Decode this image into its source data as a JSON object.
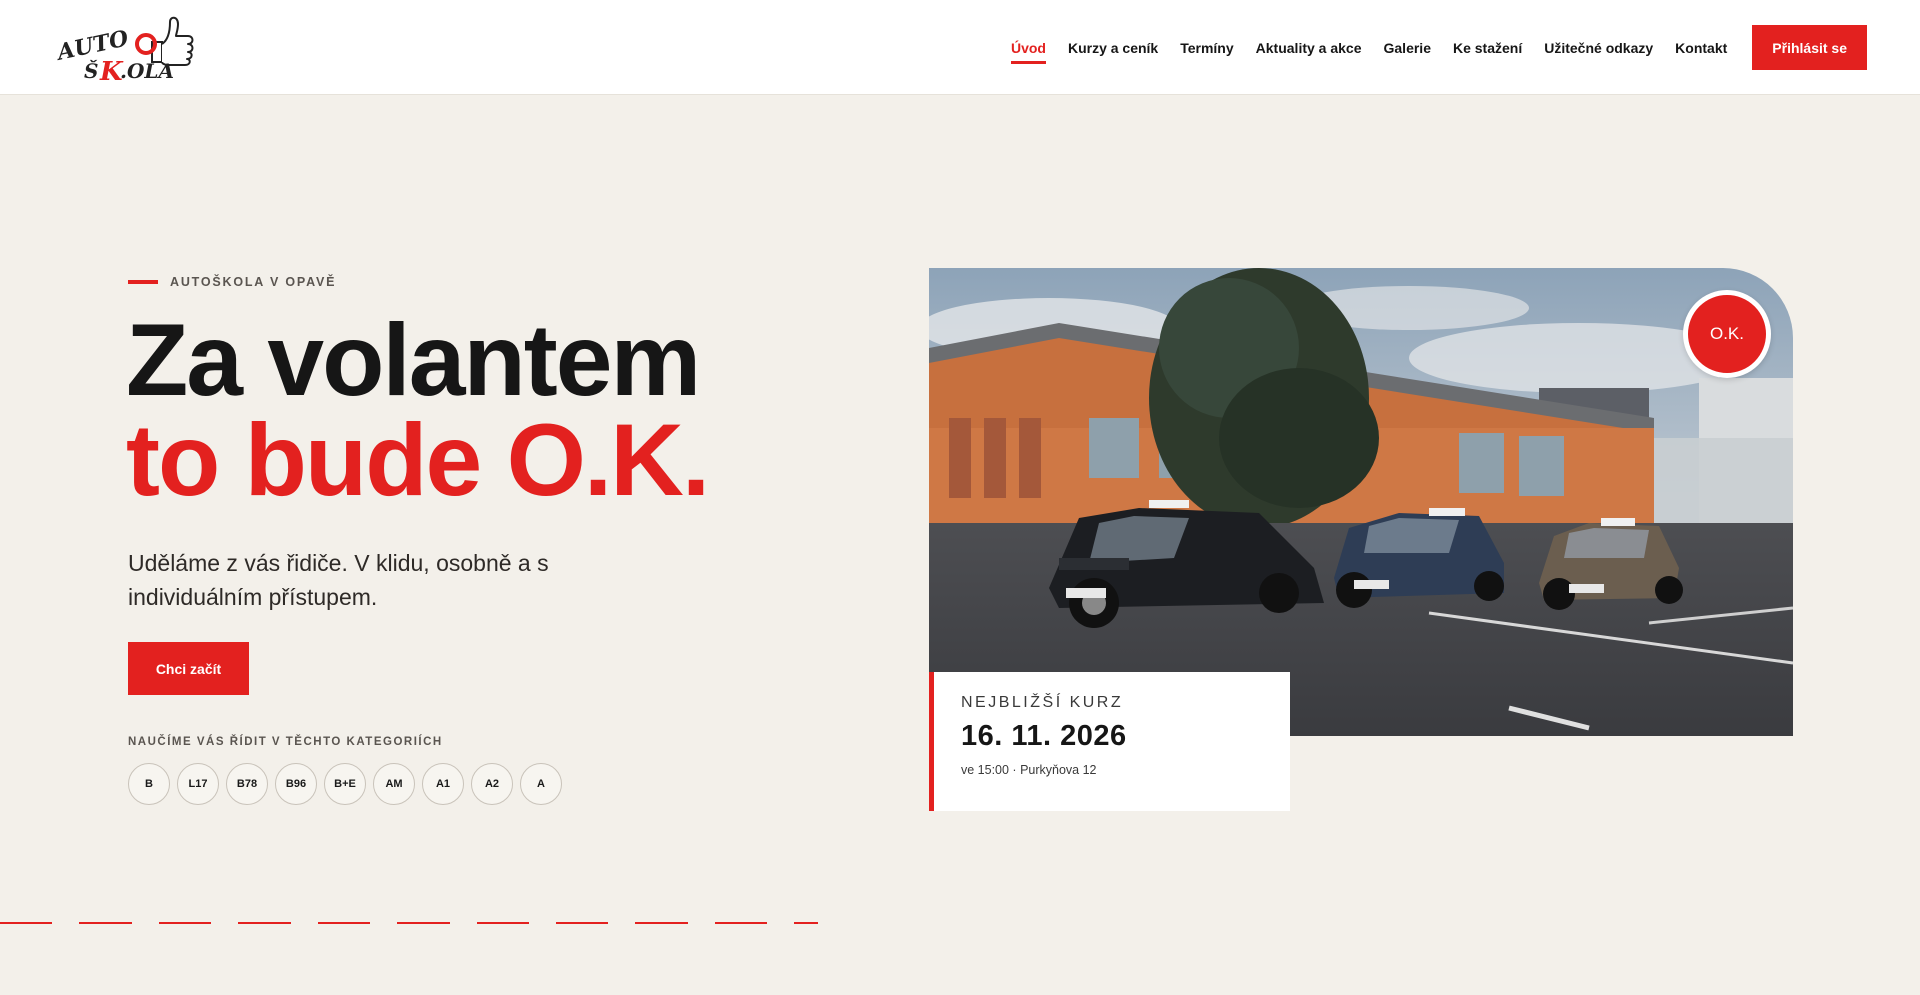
{
  "brand": {
    "logo_alt": "AUTO ŠKOLA",
    "accent": "#e3211f",
    "background": "#f3f0ea"
  },
  "nav": {
    "items": [
      {
        "label": "Úvod",
        "active": true
      },
      {
        "label": "Kurzy a ceník"
      },
      {
        "label": "Termíny"
      },
      {
        "label": "Aktuality a akce"
      },
      {
        "label": "Galerie"
      },
      {
        "label": "Ke stažení"
      },
      {
        "label": "Užitečné odkazy"
      },
      {
        "label": "Kontakt"
      }
    ],
    "login_label": "Přihlásit se"
  },
  "hero": {
    "eyebrow": "AUTOŠKOLA V OPAVĚ",
    "headline_line1": "Za volantem",
    "headline_line2": "to bude O.K.",
    "lead": "Uděláme z vás řidiče. V klidu, osobně a s individuálním přístupem.",
    "cta_label": "Chci začít",
    "categories_label": "NAUČÍME VÁS ŘÍDIT V TĚCHTO KATEGORIÍCH",
    "categories": [
      "B",
      "L17",
      "B78",
      "B96",
      "B+E",
      "AM",
      "A1",
      "A2",
      "A"
    ]
  },
  "photo": {
    "badge": "O.K."
  },
  "next_course": {
    "label": "NEJBLIŽŠÍ KURZ",
    "date": "16. 11. 2026",
    "meta": "ve 15:00 · Purkyňova 12"
  }
}
